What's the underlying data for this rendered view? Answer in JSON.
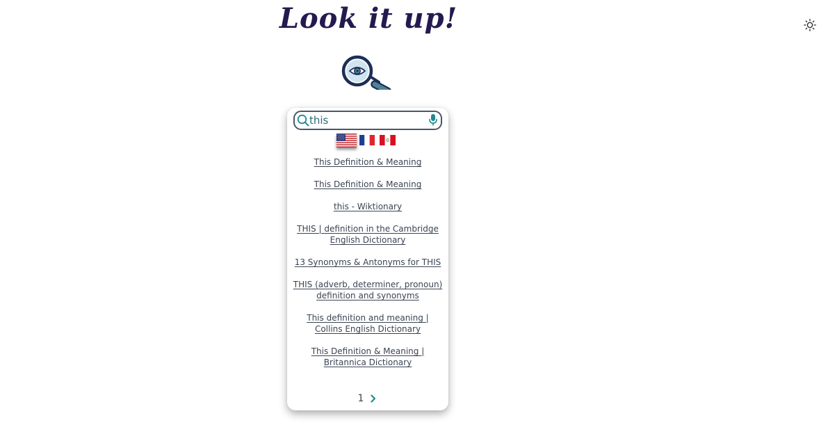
{
  "header": {
    "title": "Look it up!"
  },
  "theme_toggle": {
    "icon": "sun-icon"
  },
  "logo": {
    "icon": "magnifying-glass-eye-icon",
    "colors": {
      "ring": "#1d2e57",
      "lens": "#cfe4ef",
      "handle": "#4e8296"
    }
  },
  "search": {
    "value": "this",
    "search_icon": "search-icon",
    "mic_icon": "microphone-icon",
    "accent": "#1f8a8f"
  },
  "languages": [
    {
      "name": "us-flag",
      "selected": true
    },
    {
      "name": "france-flag",
      "selected": false
    },
    {
      "name": "peru-flag",
      "selected": false
    }
  ],
  "results": [
    {
      "text": "This Definition & Meaning"
    },
    {
      "text": "This Definition & Meaning"
    },
    {
      "text": "this - Wiktionary"
    },
    {
      "text": "THIS | definition in the Cambridge English Dictionary"
    },
    {
      "text": "13 Synonyms & Antonyms for THIS"
    },
    {
      "text": "THIS (adverb, determiner, pronoun) definition and synonyms"
    },
    {
      "text": "This definition and meaning | Collins English Dictionary"
    },
    {
      "text": "This Definition & Meaning | Britannica Dictionary"
    }
  ],
  "pagination": {
    "current_page": "1",
    "next_icon": "chevron-right-icon"
  }
}
